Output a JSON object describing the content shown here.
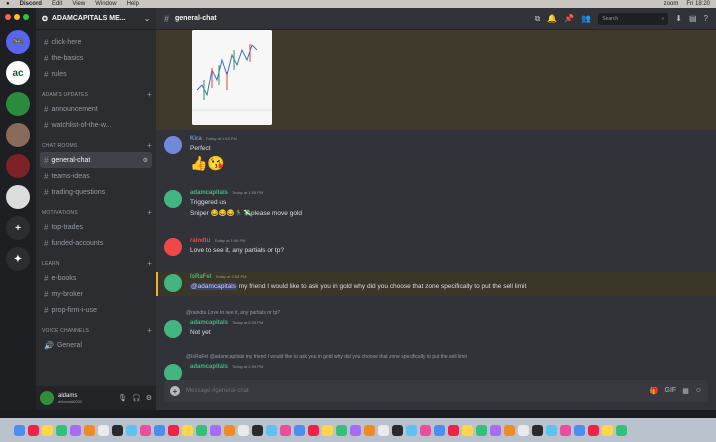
{
  "menubar": {
    "app": "Discord",
    "items": [
      "Edit",
      "View",
      "Window",
      "Help"
    ],
    "zoom_label": "zoom",
    "clock": "Fri 18:20"
  },
  "servers": [
    {
      "name": "discord-home",
      "glyph": "🎮",
      "color": "#5865f2",
      "badge": "38"
    },
    {
      "name": "adamcapitals",
      "glyph": "ac",
      "color": "#ffffff",
      "badge": ""
    },
    {
      "name": "server-green",
      "glyph": "",
      "color": "#2b8a3e",
      "badge": ""
    },
    {
      "name": "server-avatar-1",
      "glyph": "",
      "color": "#8a6b5a",
      "badge": ""
    },
    {
      "name": "server-red",
      "glyph": "",
      "color": "#7d2226",
      "badge": ""
    },
    {
      "name": "server-white",
      "glyph": "",
      "color": "#dcdcdc",
      "badge": ""
    },
    {
      "name": "add-server",
      "glyph": "+",
      "color": "#2b2d31",
      "badge": ""
    },
    {
      "name": "explore",
      "glyph": "✦",
      "color": "#2b2d31",
      "badge": ""
    }
  ],
  "guild": {
    "name": "ADAMCAPITALS ME..."
  },
  "sidebar": {
    "top_channels": [
      "click-here",
      "the-basics",
      "rules"
    ],
    "categories": [
      {
        "title": "ADAM'S UPDATES",
        "channels": [
          "announcement",
          "watchlist-of-the-w..."
        ]
      },
      {
        "title": "CHAT ROOMS",
        "channels": [
          "general-chat",
          "teams-ideas",
          "trading-questions"
        ]
      },
      {
        "title": "MOTIVATIONS",
        "channels": [
          "top-trades",
          "funded-accounts"
        ]
      },
      {
        "title": "LEARN",
        "channels": [
          "e-books",
          "my-broker",
          "prop-firm-i-use"
        ]
      },
      {
        "title": "VOICE CHANNELS",
        "channels": [
          "General"
        ]
      }
    ]
  },
  "user": {
    "name": "aldams",
    "status": "aldams#0000"
  },
  "header": {
    "channel": "general-chat",
    "search_placeholder": "Search"
  },
  "messages": [
    {
      "author": "Kira",
      "time": "Today at 1:53 PM",
      "text": "Perfect",
      "extra": "👍😘",
      "color": "#7289da"
    },
    {
      "author": "adamcapitals",
      "time": "Today at 1:55 PM",
      "text": "Triggered us",
      "extra": "Sniper 😂😂😂🏃‍♂️💸please move gold",
      "color": "#43b581"
    },
    {
      "author": "raindtu",
      "time": "Today at 1:56 PM",
      "text": "Love to see it, any partials or tp?",
      "color": "#f04747"
    },
    {
      "author": "IsRaFel",
      "time": "Today at 2:08 PM",
      "mention": "@adamcapitals",
      "text": "my friend I would like to ask you in gold why did you choose that zone specifically to put the sell limit",
      "color": "#43b581"
    },
    {
      "author": "adamcapitals",
      "time": "Today at 2:09 PM",
      "reply": "@raindtu Love to see it, any partials or tp?",
      "text": "Not yet",
      "color": "#43b581"
    },
    {
      "author": "adamcapitals",
      "time": "Today at 2:09 PM",
      "reply": "@IsRaFel @adamcapitals my friend I would like to ask you in gold why did you choose that zone specifically to put the sell limit",
      "text": "",
      "color": "#43b581"
    }
  ],
  "composer": {
    "placeholder": "Message #general-chat"
  },
  "dock": {
    "count": 44
  }
}
